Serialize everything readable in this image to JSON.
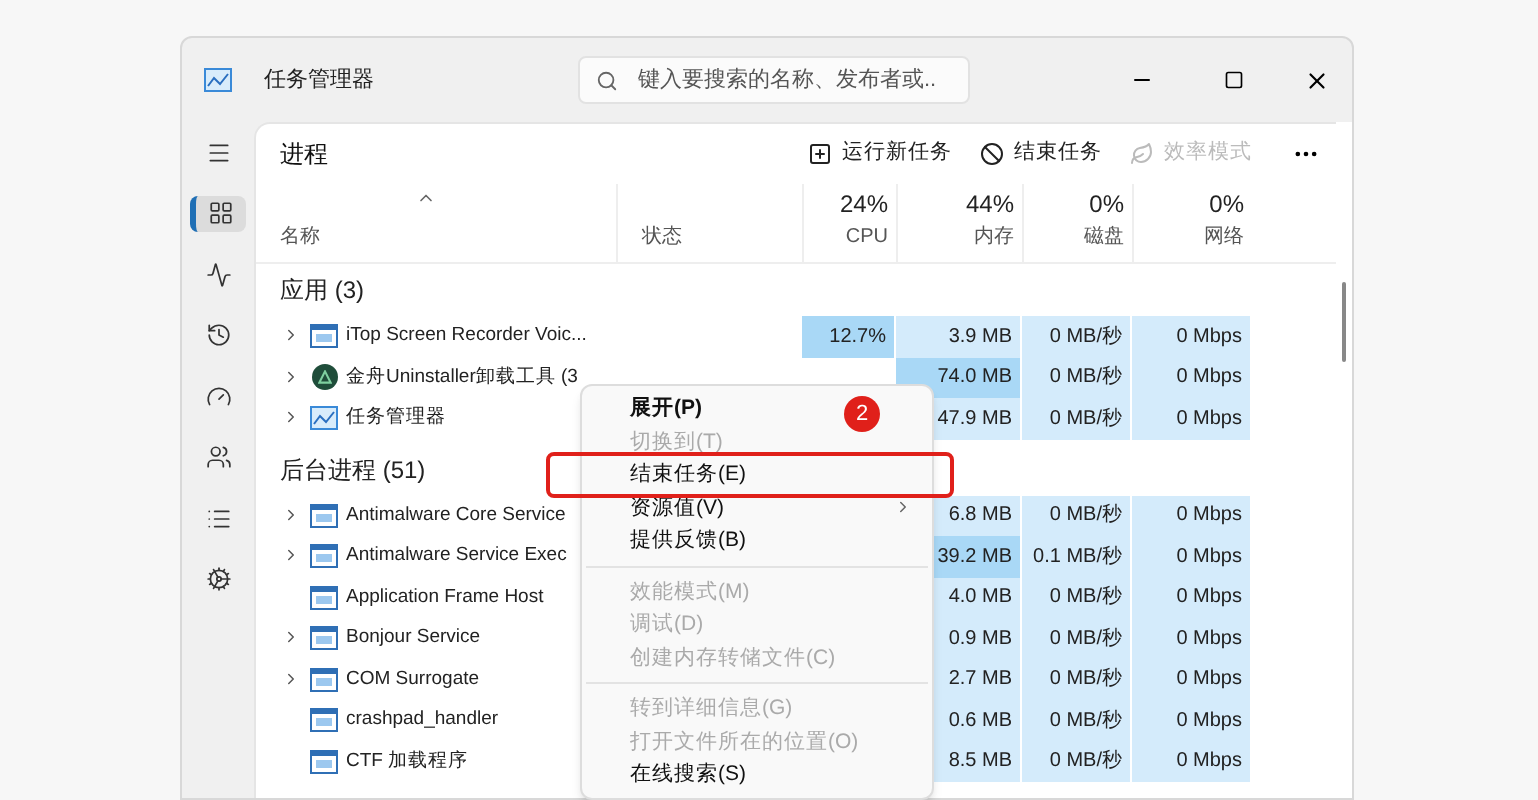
{
  "window": {
    "title": "任务管理器",
    "search": {
      "placeholder": "键入要搜索的名称、发布者或..."
    }
  },
  "nav": [
    {
      "kind": "menu",
      "selected": false
    },
    {
      "kind": "processes",
      "selected": true
    },
    {
      "kind": "performance",
      "selected": false
    },
    {
      "kind": "history",
      "selected": false
    },
    {
      "kind": "startup",
      "selected": false
    },
    {
      "kind": "users",
      "selected": false
    },
    {
      "kind": "details",
      "selected": false
    },
    {
      "kind": "services",
      "selected": false
    }
  ],
  "page": {
    "title": "进程",
    "actions": [
      {
        "kind": "run",
        "label": "运行新任务",
        "disabled": false
      },
      {
        "kind": "end",
        "label": "结束任务",
        "disabled": false
      },
      {
        "kind": "efficiency",
        "label": "效率模式",
        "disabled": true
      }
    ]
  },
  "table": {
    "columns": [
      {
        "label": "名称"
      },
      {
        "label": "状态"
      },
      {
        "label": "CPU",
        "total": "24%"
      },
      {
        "label": "内存",
        "total": "44%"
      },
      {
        "label": "磁盘",
        "total": "0%"
      },
      {
        "label": "网络",
        "total": "0%"
      }
    ],
    "groups": [
      {
        "title": "应用 (3)",
        "rows": [
          {
            "name": "iTop Screen Recorder Voic...",
            "expandable": true,
            "cells": [
              {
                "text": "12.7%",
                "color": "#a9d8f6"
              },
              {
                "text": "3.9 MB",
                "color": "#d4ebfb"
              },
              {
                "text": "0 MB/秒",
                "color": "#d4ebfb"
              },
              {
                "text": "0 Mbps",
                "color": "#d4ebfb"
              }
            ]
          },
          {
            "name": "金舟Uninstaller卸载工具 (3",
            "expandable": true,
            "cells": [
              null,
              {
                "text": "74.0 MB",
                "color": "#a9d8f6"
              },
              {
                "text": "0 MB/秒",
                "color": "#d4ebfb"
              },
              {
                "text": "0 Mbps",
                "color": "#d4ebfb"
              }
            ]
          },
          {
            "name": "任务管理器",
            "expandable": true,
            "cells": [
              null,
              {
                "text": "47.9 MB",
                "color": "#d4ebfb"
              },
              {
                "text": "0 MB/秒",
                "color": "#d4ebfb"
              },
              {
                "text": "0 Mbps",
                "color": "#d4ebfb"
              }
            ]
          }
        ]
      },
      {
        "title": "后台进程 (51)",
        "rows": [
          {
            "name": "Antimalware Core Service",
            "expandable": true,
            "cells": [
              null,
              {
                "text": "6.8 MB",
                "color": "#d4ebfb"
              },
              {
                "text": "0 MB/秒",
                "color": "#d4ebfb"
              },
              {
                "text": "0 Mbps",
                "color": "#d4ebfb"
              }
            ]
          },
          {
            "name": "Antimalware Service Exec",
            "expandable": true,
            "cells": [
              null,
              {
                "text": "39.2 MB",
                "color": "#a9d8f6"
              },
              {
                "text": "0.1 MB/秒",
                "color": "#d4ebfb"
              },
              {
                "text": "0 Mbps",
                "color": "#d4ebfb"
              }
            ]
          },
          {
            "name": "Application Frame Host",
            "expandable": false,
            "cells": [
              null,
              {
                "text": "4.0 MB",
                "color": "#d4ebfb"
              },
              {
                "text": "0 MB/秒",
                "color": "#d4ebfb"
              },
              {
                "text": "0 Mbps",
                "color": "#d4ebfb"
              }
            ]
          },
          {
            "name": "Bonjour Service",
            "expandable": true,
            "cells": [
              null,
              {
                "text": "0.9 MB",
                "color": "#d4ebfb"
              },
              {
                "text": "0 MB/秒",
                "color": "#d4ebfb"
              },
              {
                "text": "0 Mbps",
                "color": "#d4ebfb"
              }
            ]
          },
          {
            "name": "COM Surrogate",
            "expandable": true,
            "cells": [
              null,
              {
                "text": "2.7 MB",
                "color": "#d4ebfb"
              },
              {
                "text": "0 MB/秒",
                "color": "#d4ebfb"
              },
              {
                "text": "0 Mbps",
                "color": "#d4ebfb"
              }
            ]
          },
          {
            "name": "crashpad_handler",
            "expandable": false,
            "cells": [
              null,
              {
                "text": "0.6 MB",
                "color": "#d4ebfb"
              },
              {
                "text": "0 MB/秒",
                "color": "#d4ebfb"
              },
              {
                "text": "0 Mbps",
                "color": "#d4ebfb"
              }
            ]
          },
          {
            "name": "CTF 加载程序",
            "expandable": false,
            "cells": [
              null,
              {
                "text": "8.5 MB",
                "color": "#d4ebfb"
              },
              {
                "text": "0 MB/秒",
                "color": "#d4ebfb"
              },
              {
                "text": "0 Mbps",
                "color": "#d4ebfb"
              }
            ]
          }
        ]
      }
    ]
  },
  "context_menu": {
    "items": [
      {
        "kind": "item",
        "label": "展开(P)",
        "disabled": false,
        "bold": true,
        "submenu": false
      },
      {
        "kind": "item",
        "label": "切换到(T)",
        "disabled": true,
        "bold": false,
        "submenu": false
      },
      {
        "kind": "item",
        "label": "结束任务(E)",
        "disabled": false,
        "bold": false,
        "submenu": false
      },
      {
        "kind": "item",
        "label": "资源值(V)",
        "disabled": false,
        "bold": false,
        "submenu": true
      },
      {
        "kind": "item",
        "label": "提供反馈(B)",
        "disabled": false,
        "bold": false,
        "submenu": false
      },
      {
        "kind": "separator"
      },
      {
        "kind": "item",
        "label": "效能模式(M)",
        "disabled": true,
        "bold": false,
        "submenu": false
      },
      {
        "kind": "item",
        "label": "调试(D)",
        "disabled": true,
        "bold": false,
        "submenu": false
      },
      {
        "kind": "item",
        "label": "创建内存转储文件(C)",
        "disabled": true,
        "bold": false,
        "submenu": false
      },
      {
        "kind": "separator"
      },
      {
        "kind": "item",
        "label": "转到详细信息(G)",
        "disabled": true,
        "bold": false,
        "submenu": false
      },
      {
        "kind": "item",
        "label": "打开文件所在的位置(O)",
        "disabled": true,
        "bold": false,
        "submenu": false
      },
      {
        "kind": "item",
        "label": "在线搜索(S)",
        "disabled": false,
        "bold": false,
        "submenu": false
      }
    ]
  },
  "annotation": {
    "step": "2"
  }
}
